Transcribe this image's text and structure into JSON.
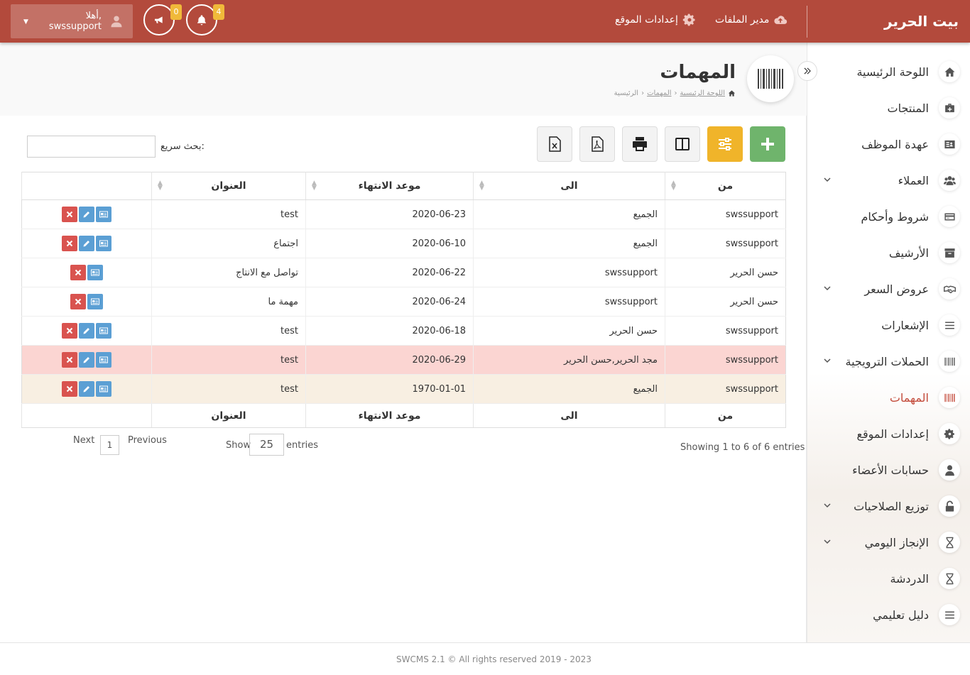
{
  "app": {
    "brand": "بيت الحرير"
  },
  "topbar": {
    "file_manager": "مدير الملفات",
    "site_settings": "إعدادات الموقع",
    "announce_count": "0",
    "notif_count": "4",
    "user_greeting": "أهلا,",
    "user_name": "swssupport"
  },
  "sidebar": {
    "items": [
      {
        "label": "اللوحة الرئيسية",
        "icon": "home-icon"
      },
      {
        "label": "المنتجات",
        "icon": "medkit-icon"
      },
      {
        "label": "عهدة الموظف",
        "icon": "id-card-icon"
      },
      {
        "label": "العملاء",
        "icon": "users-icon",
        "has_sub": true
      },
      {
        "label": "شروط وأحكام",
        "icon": "credit-card-icon"
      },
      {
        "label": "الأرشيف",
        "icon": "archive-icon"
      },
      {
        "label": "عروض السعر",
        "icon": "handshake-icon",
        "has_sub": true
      },
      {
        "label": "الإشعارات",
        "icon": "list-icon"
      },
      {
        "label": "الحملات الترويجية",
        "icon": "barcode-icon",
        "has_sub": true
      },
      {
        "label": "المهمات",
        "icon": "barcode-icon",
        "active": true
      },
      {
        "label": "إعدادات الموقع",
        "icon": "gear-icon"
      },
      {
        "label": "حسابات الأعضاء",
        "icon": "user-icon"
      },
      {
        "label": "توزيع الصلاحيات",
        "icon": "lock-icon",
        "has_sub": true
      },
      {
        "label": "الإنجاز اليومي",
        "icon": "hourglass-icon",
        "has_sub": true
      },
      {
        "label": "الدردشة",
        "icon": "hourglass-icon"
      },
      {
        "label": "دليل تعليمي",
        "icon": "list-icon"
      }
    ]
  },
  "page": {
    "title": "المهمات",
    "breadcrumb": [
      "اللوحة الرئيسية",
      "المهمات",
      "الرئيسية"
    ]
  },
  "search": {
    "label": "بحث سريع:",
    "value": ""
  },
  "table": {
    "columns": [
      "من",
      "الى",
      "موعد الانتهاء",
      "العنوان"
    ],
    "rows": [
      {
        "from": "swssupport",
        "to": "الجميع",
        "due": "2020-06-23",
        "title": "test",
        "edit": true,
        "style": ""
      },
      {
        "from": "swssupport",
        "to": "الجميع",
        "due": "2020-06-10",
        "title": "اجتماع",
        "edit": true,
        "style": ""
      },
      {
        "from": "حسن الحرير",
        "to": "swssupport",
        "due": "2020-06-22",
        "title": "تواصل مع الانتاج",
        "edit": false,
        "style": ""
      },
      {
        "from": "حسن الحرير",
        "to": "swssupport",
        "due": "2020-06-24",
        "title": "مهمة ما",
        "edit": false,
        "style": ""
      },
      {
        "from": "swssupport",
        "to": "حسن الحرير",
        "due": "2020-06-18",
        "title": "test",
        "edit": true,
        "style": ""
      },
      {
        "from": "swssupport",
        "to": "مجد الحرير,حسن الحرير",
        "due": "2020-06-29",
        "title": "test",
        "edit": true,
        "style": "danger"
      },
      {
        "from": "swssupport",
        "to": "الجميع",
        "due": "1970-01-01",
        "title": "test",
        "edit": true,
        "style": "warn"
      }
    ]
  },
  "pagination": {
    "next": "Next",
    "page": "1",
    "previous": "Previous",
    "show": "Show",
    "length": "25",
    "entries": "entries",
    "info": "Showing 1 to 6 of 6 entries"
  },
  "footer": {
    "text": "SWCMS 2.1 © All rights reserved 2019 - 2023"
  },
  "colors": {
    "topbar": "#b34a3c",
    "add": "#6fb46c",
    "filter": "#f0b42a",
    "danger_row": "#fbd5d2",
    "warn_row": "#f8efe2",
    "active_nav": "#c34a3a"
  }
}
